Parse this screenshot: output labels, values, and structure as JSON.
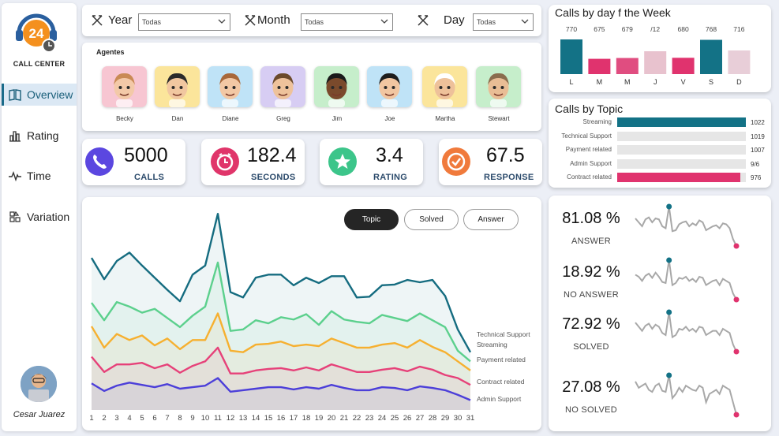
{
  "brand": {
    "logo_text": "24",
    "name": "CALL CENTER"
  },
  "nav": [
    {
      "label": "Overview",
      "icon": "book-icon",
      "active": true
    },
    {
      "label": "Rating",
      "icon": "bar-chart-icon",
      "active": false
    },
    {
      "label": "Time",
      "icon": "pulse-icon",
      "active": false
    },
    {
      "label": "Variation",
      "icon": "shapes-icon",
      "active": false
    }
  ],
  "user": {
    "name": "Cesar Juarez"
  },
  "filters": [
    {
      "label": "Year",
      "value": "Todas"
    },
    {
      "label": "Month",
      "value": "Todas"
    },
    {
      "label": "Day",
      "value": "Todas"
    }
  ],
  "agents": {
    "title": "Agentes",
    "list": [
      {
        "name": "Becky",
        "bg": "#f7c6d2"
      },
      {
        "name": "Dan",
        "bg": "#fbe59b"
      },
      {
        "name": "Diane",
        "bg": "#bfe3f7"
      },
      {
        "name": "Greg",
        "bg": "#d7cdf3"
      },
      {
        "name": "Jim",
        "bg": "#c6eecb"
      },
      {
        "name": "Joe",
        "bg": "#bfe3f7"
      },
      {
        "name": "Martha",
        "bg": "#fbe59b"
      },
      {
        "name": "Stewart",
        "bg": "#c6eecb"
      }
    ]
  },
  "kpis": [
    {
      "value": "5000",
      "label": "CALLS",
      "color": "#5b47e0",
      "icon": "phone-icon"
    },
    {
      "value": "182.4",
      "label": "SECONDS",
      "color": "#e0356a",
      "icon": "clock-icon"
    },
    {
      "value": "3.4",
      "label": "RATING",
      "color": "#3cc58a",
      "icon": "star-icon"
    },
    {
      "value": "67.5",
      "label": "RESPONSE",
      "color": "#f07a3c",
      "icon": "check-circle-icon"
    }
  ],
  "main_chart": {
    "toggles": [
      {
        "label": "Topic",
        "active": true
      },
      {
        "label": "Solved",
        "active": false
      },
      {
        "label": "Answer",
        "active": false
      }
    ],
    "chart_data": {
      "type": "area",
      "x": [
        1,
        2,
        3,
        4,
        5,
        6,
        7,
        8,
        9,
        10,
        11,
        12,
        13,
        14,
        15,
        16,
        17,
        18,
        19,
        20,
        21,
        22,
        23,
        24,
        25,
        26,
        27,
        28,
        29,
        30,
        31
      ],
      "series": [
        {
          "name": "Technical Support",
          "color": "#156c80",
          "values": [
            200,
            172,
            196,
            207,
            190,
            174,
            158,
            143,
            178,
            190,
            258,
            155,
            148,
            174,
            178,
            178,
            164,
            174,
            167,
            176,
            176,
            148,
            149,
            164,
            165,
            171,
            168,
            171,
            150,
            106,
            76
          ]
        },
        {
          "name": "Streaming",
          "color": "#5cd08d",
          "values": [
            141,
            118,
            142,
            136,
            128,
            133,
            121,
            109,
            124,
            136,
            194,
            104,
            106,
            118,
            114,
            122,
            119,
            126,
            112,
            130,
            119,
            116,
            114,
            125,
            121,
            117,
            127,
            118,
            109,
            78,
            64
          ]
        },
        {
          "name": "Payment related",
          "color": "#f6b030",
          "values": [
            110,
            82,
            100,
            92,
            98,
            85,
            94,
            80,
            92,
            92,
            127,
            78,
            76,
            86,
            87,
            90,
            84,
            86,
            84,
            94,
            88,
            82,
            82,
            86,
            88,
            82,
            92,
            83,
            76,
            64,
            52
          ]
        },
        {
          "name": "Contract related",
          "color": "#e64179",
          "values": [
            70,
            50,
            60,
            60,
            62,
            55,
            60,
            49,
            58,
            64,
            82,
            48,
            48,
            52,
            54,
            55,
            52,
            56,
            52,
            60,
            55,
            50,
            50,
            53,
            55,
            51,
            57,
            53,
            46,
            42,
            33
          ]
        },
        {
          "name": "Admin Support",
          "color": "#4c3fd9",
          "values": [
            35,
            25,
            32,
            36,
            33,
            30,
            34,
            28,
            30,
            32,
            42,
            24,
            26,
            28,
            30,
            30,
            27,
            30,
            28,
            33,
            29,
            26,
            26,
            30,
            29,
            26,
            31,
            29,
            26,
            20,
            13
          ]
        }
      ],
      "ylim": [
        0,
        280
      ]
    }
  },
  "calls_by_day": {
    "title": "Calls by day f the Week",
    "chart_data": {
      "type": "bar",
      "categories": [
        "L",
        "M",
        "M",
        "J",
        "V",
        "S",
        "D"
      ],
      "values": [
        770,
        675,
        679,
        712,
        680,
        768,
        716
      ],
      "value_labels": [
        "770",
        "675",
        "679",
        "/12",
        "680",
        "768",
        "716"
      ],
      "colors": [
        "#137286",
        "#e0336e",
        "#e04d80",
        "#e8c2ce",
        "#e0336e",
        "#137286",
        "#e8ced8"
      ],
      "ylim": [
        0,
        770
      ]
    }
  },
  "calls_by_topic": {
    "title": "Calls by Topic",
    "chart_data": {
      "type": "bar",
      "categories": [
        "Streaming",
        "Technical Support",
        "Payment related",
        "Admin Support",
        "Contract related"
      ],
      "values": [
        1022,
        1019,
        1007,
        976,
        976
      ],
      "value_labels": [
        "1022",
        "1019",
        "1007",
        "9/6",
        "976"
      ],
      "colors": [
        "#137286",
        "#e6e6e6",
        "#e6e6e6",
        "#e6e6e6",
        "#e0336e"
      ],
      "xlim": [
        0,
        1022
      ]
    }
  },
  "sparks": [
    {
      "value": "81.08 %",
      "label": "ANSWER",
      "values": [
        48,
        44,
        40,
        47,
        49,
        44,
        48,
        47,
        40,
        38,
        60,
        35,
        36,
        42,
        44,
        45,
        40,
        43,
        41,
        46,
        44,
        36,
        38,
        40,
        41,
        38,
        43,
        42,
        38,
        27,
        20
      ]
    },
    {
      "value": "18.92 %",
      "label": "NO ANSWER",
      "values": [
        48,
        46,
        42,
        47,
        49,
        45,
        50,
        46,
        41,
        40,
        62,
        38,
        40,
        45,
        44,
        46,
        42,
        44,
        41,
        46,
        45,
        38,
        40,
        42,
        43,
        38,
        44,
        42,
        40,
        30,
        24
      ]
    },
    {
      "value": "72.92 %",
      "label": "SOLVED",
      "values": [
        50,
        46,
        42,
        47,
        49,
        44,
        48,
        46,
        40,
        38,
        60,
        36,
        38,
        44,
        43,
        46,
        42,
        44,
        41,
        46,
        45,
        38,
        40,
        42,
        42,
        38,
        44,
        42,
        40,
        29,
        22
      ]
    },
    {
      "value": "27.08 %",
      "label": "NO SOLVED",
      "values": [
        50,
        44,
        46,
        48,
        42,
        40,
        46,
        48,
        41,
        40,
        56,
        34,
        38,
        44,
        40,
        46,
        44,
        42,
        41,
        46,
        44,
        30,
        38,
        40,
        42,
        38,
        46,
        44,
        42,
        30,
        18
      ]
    }
  ]
}
